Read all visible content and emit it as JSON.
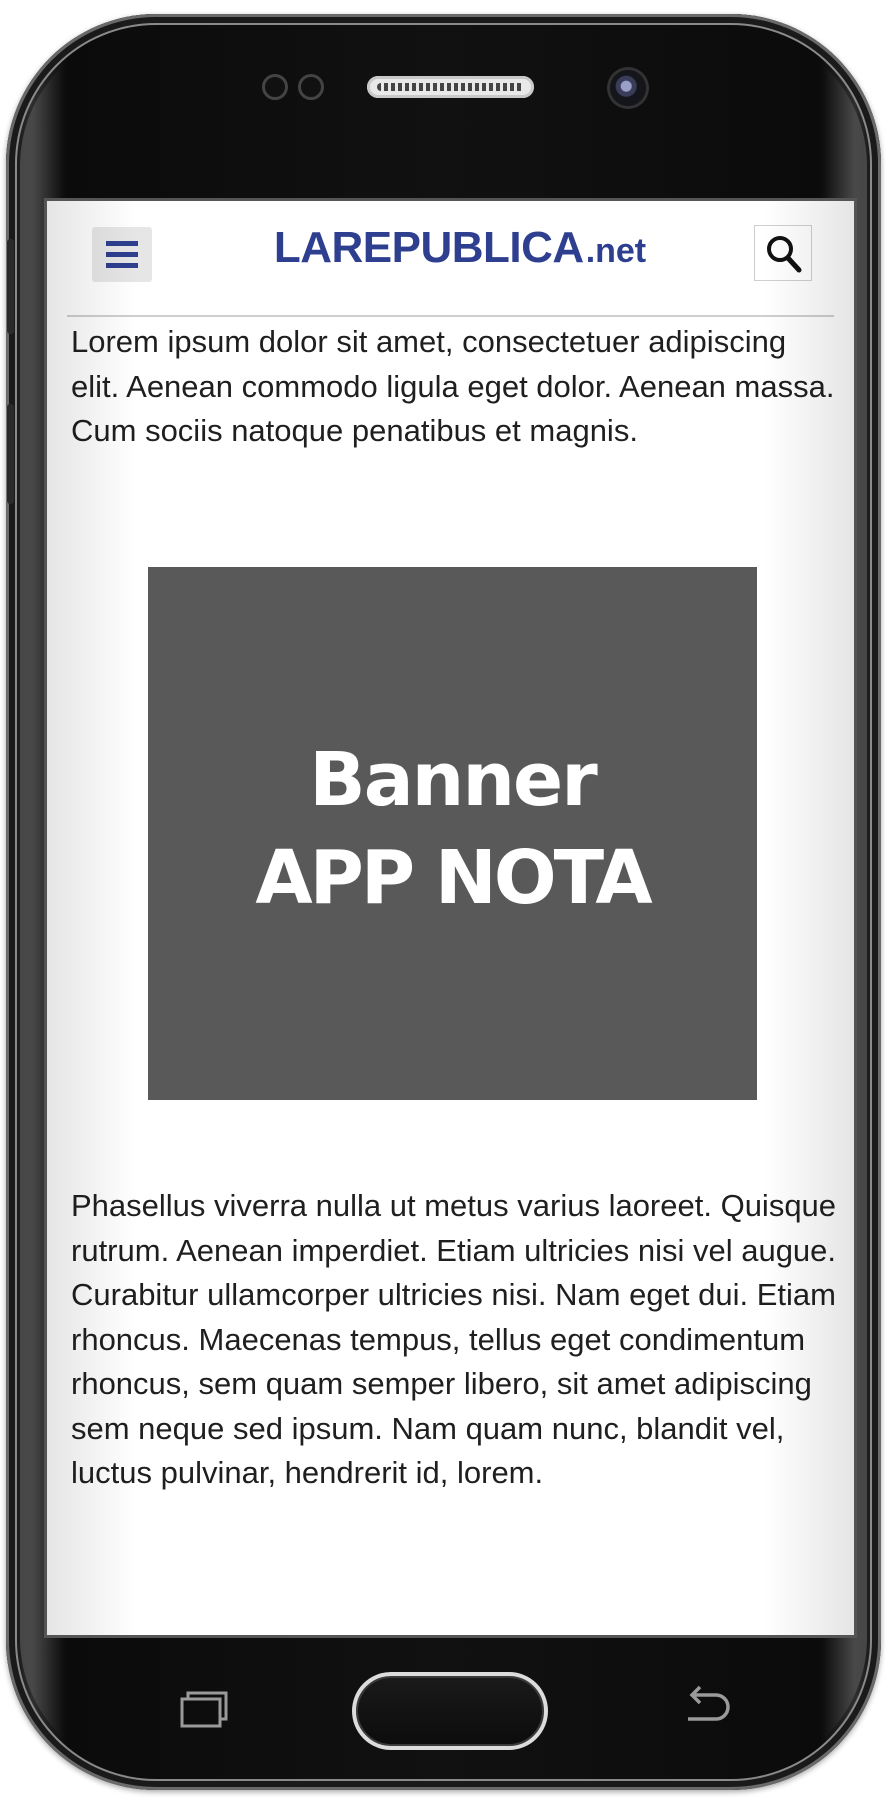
{
  "header": {
    "logo_main": "LAREPUBLICA",
    "logo_tld": ".net",
    "menu_icon": "hamburger-menu-icon",
    "search_icon": "search-icon",
    "brand_color": "#2e3f8f"
  },
  "article": {
    "paragraph_1": "Lorem ipsum dolor sit amet, consectetuer adipiscing elit. Aenean commodo ligula eget dolor. Aenean massa. Cum sociis natoque penatibus et magnis.",
    "paragraph_2": "Phasellus viverra nulla ut metus varius laoreet. Quisque rutrum. Aenean imperdiet. Etiam ultricies nisi vel augue. Curabitur ullamcorper ultricies nisi. Nam eget dui. Etiam rhoncus. Maecenas tempus, tellus eget condimentum rhoncus, sem quam semper libero, sit amet adipiscing sem neque sed ipsum. Nam quam nunc, blandit vel, luctus pulvinar, hendrerit id, lorem."
  },
  "banner": {
    "line_1": "Banner",
    "line_2": "APP NOTA",
    "background_color": "#595959"
  },
  "navbar": {
    "recents_icon": "recent-apps-icon",
    "home_icon": "home-button-icon",
    "back_icon": "back-arrow-icon"
  }
}
